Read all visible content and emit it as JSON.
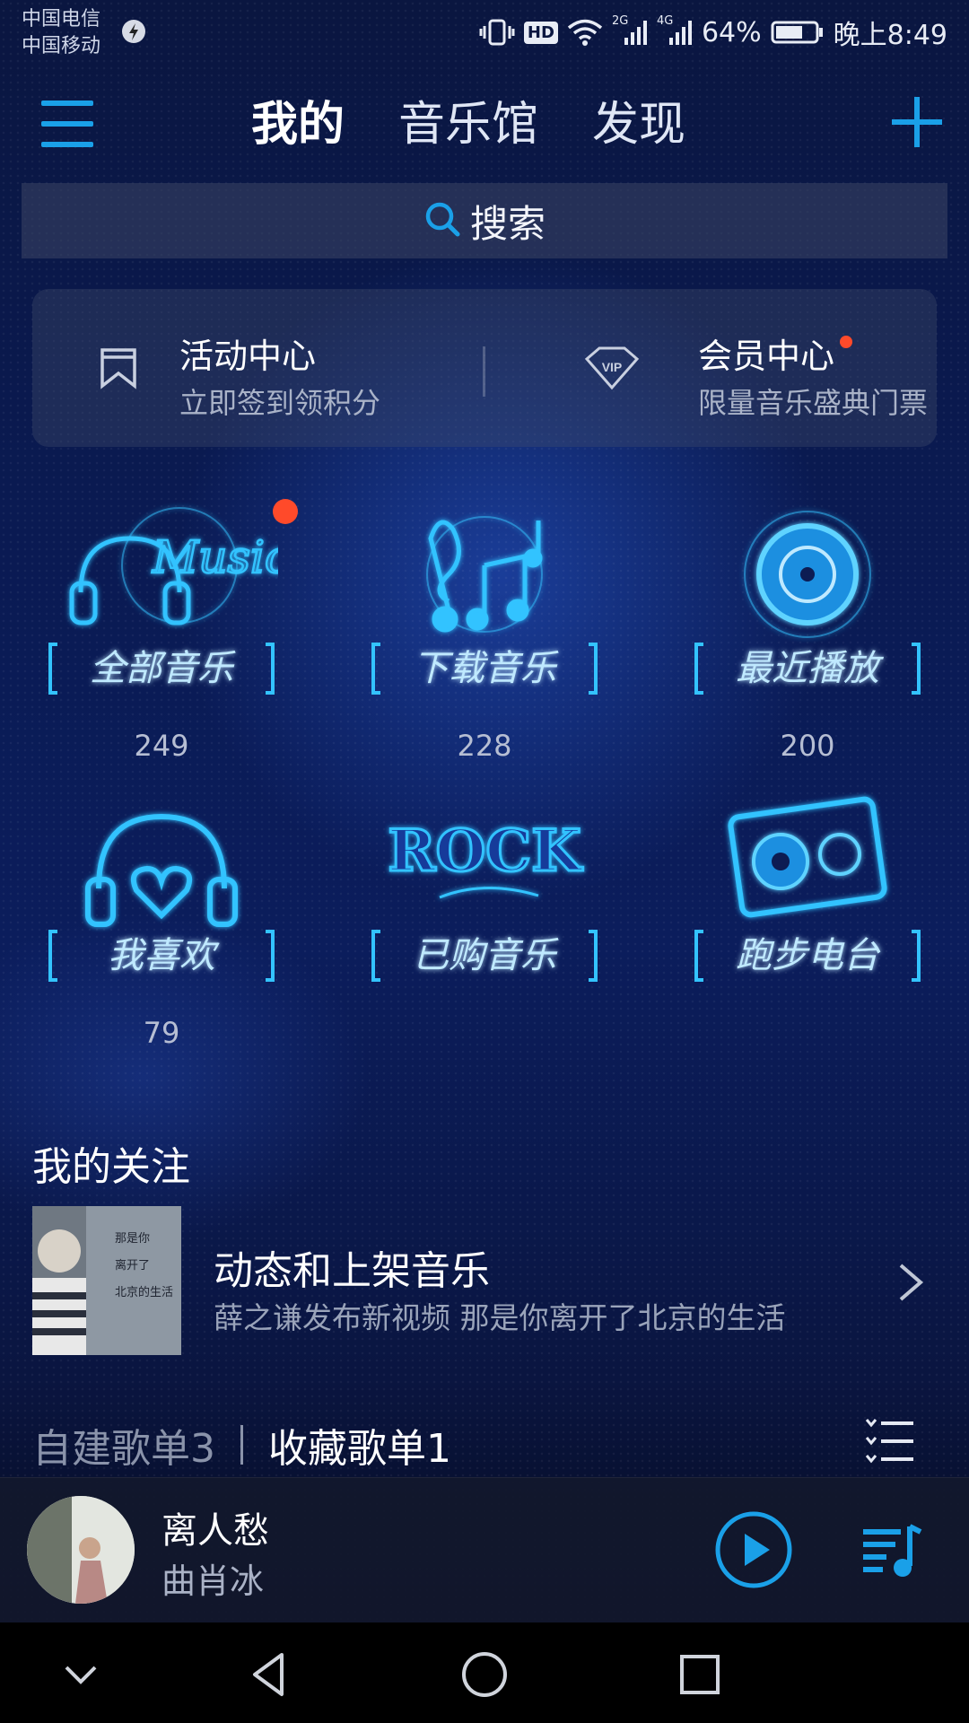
{
  "status_bar": {
    "carrier_1": "中国电信",
    "carrier_2": "中国移动",
    "battery": "64%",
    "time": "晚上8:49",
    "hd_badge": "HD",
    "net_1": "2G",
    "net_2": "4G"
  },
  "top_nav": {
    "tabs": [
      {
        "label": "我的",
        "active": true
      },
      {
        "label": "音乐馆",
        "active": false
      },
      {
        "label": "发现",
        "active": false
      }
    ]
  },
  "search": {
    "label": "搜索"
  },
  "activity_card": {
    "left": {
      "title": "活动中心",
      "subtitle": "立即签到领积分",
      "icon": "bookmark-icon"
    },
    "right": {
      "title": "会员中心",
      "subtitle": "限量音乐盛典门票",
      "icon": "vip-icon",
      "badge": "VIP"
    }
  },
  "library": [
    {
      "label": "全部音乐",
      "count": "249",
      "art_word": "Music"
    },
    {
      "label": "下载音乐",
      "count": "228"
    },
    {
      "label": "最近播放",
      "count": "200"
    },
    {
      "label": "我喜欢",
      "count": "79"
    },
    {
      "label": "已购音乐",
      "count": "",
      "art_word": "ROCK"
    },
    {
      "label": "跑步电台",
      "count": ""
    }
  ],
  "my_follow": {
    "title": "我的关注",
    "item": {
      "title": "动态和上架音乐",
      "subtitle": "薛之谦发布新视频 那是你离开了北京的生活",
      "thumb_lines": [
        "那是你",
        "离开了",
        "北京的生活"
      ]
    }
  },
  "playlists": {
    "tabs": [
      {
        "label": "自建歌单3",
        "active": false
      },
      {
        "label": "收藏歌单1",
        "active": true
      }
    ]
  },
  "player": {
    "title": "离人愁",
    "artist": "曲肖冰"
  },
  "colors": {
    "accent": "#1aa0e8",
    "badge_red": "#ff4a2a",
    "neon": "#33c3ff"
  }
}
